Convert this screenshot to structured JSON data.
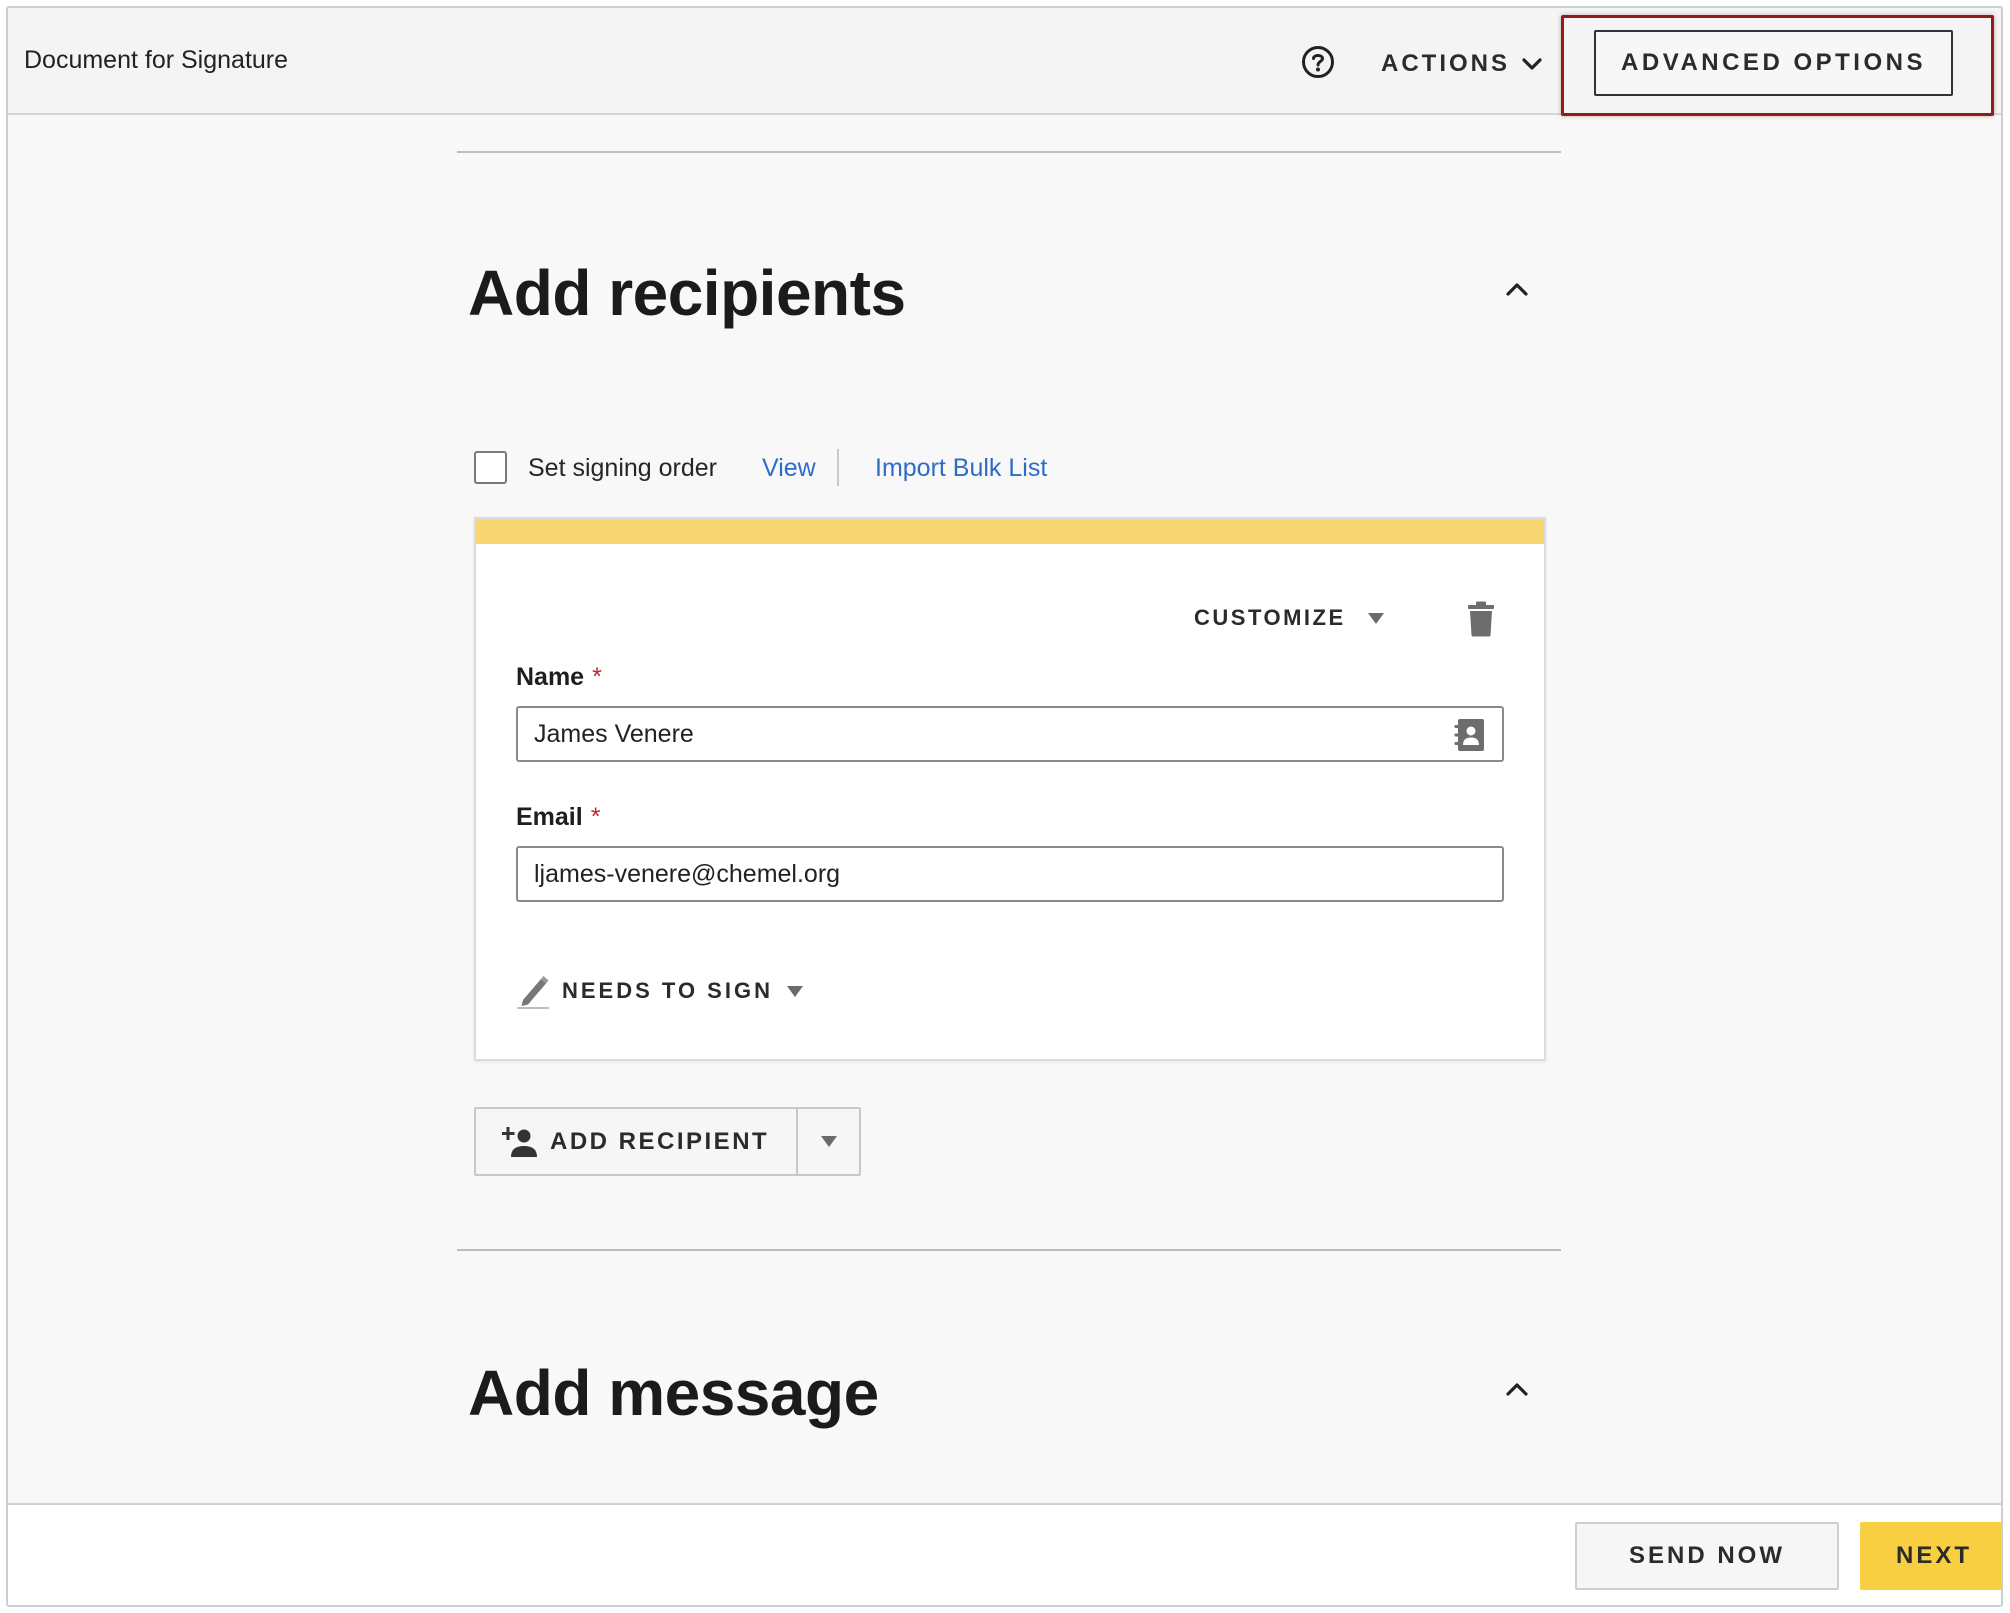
{
  "header": {
    "title": "Document for Signature",
    "help_icon": "help-circle-icon",
    "actions_label": "ACTIONS",
    "advanced_options_label": "ADVANCED OPTIONS",
    "highlight_color": "#8e1d1b"
  },
  "recipients_section": {
    "title": "Add recipients",
    "set_signing_order_label": "Set signing order",
    "set_signing_order_checked": false,
    "view_link": "View",
    "import_bulk_list_link": "Import Bulk List",
    "recipient": {
      "stripe_color": "#f8d672",
      "customize_label": "CUSTOMIZE",
      "name_label": "Name",
      "name_required_mark": "*",
      "name_value": "James Venere",
      "email_label": "Email",
      "email_required_mark": "*",
      "email_value": "ljames-venere@chemel.org",
      "role_label": "NEEDS TO SIGN"
    },
    "add_recipient_label": "ADD RECIPIENT"
  },
  "message_section": {
    "title": "Add message"
  },
  "footer": {
    "send_now_label": "SEND NOW",
    "next_label": "NEXT",
    "next_color": "#f8cf40"
  }
}
